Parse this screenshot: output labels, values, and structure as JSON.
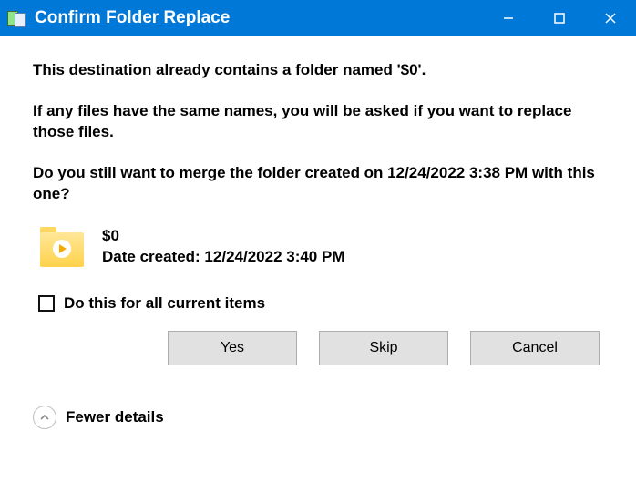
{
  "titlebar": {
    "title": "Confirm Folder Replace"
  },
  "messages": {
    "line1": "This destination already contains a folder named '$0'.",
    "line2": "If any files have the same names, you will be asked if you want to replace those files.",
    "line3": "Do you still want to merge the folder created on 12/24/2022 3:38 PM with this one?"
  },
  "folder": {
    "name": "$0",
    "date_created_label": "Date created: 12/24/2022 3:40 PM"
  },
  "checkbox": {
    "label": "Do this for all current items",
    "checked": false
  },
  "buttons": {
    "yes": "Yes",
    "skip": "Skip",
    "cancel": "Cancel"
  },
  "footer": {
    "toggle": "Fewer details"
  }
}
